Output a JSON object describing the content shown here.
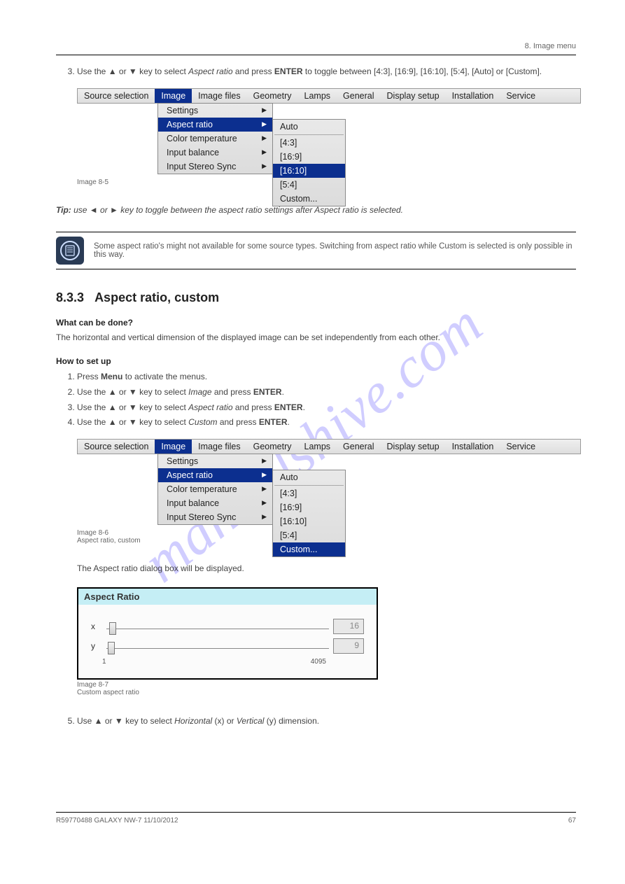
{
  "watermark": "manualshive.com",
  "chapter": "8. Image menu",
  "intro_steps": [
    {
      "t": "Use the ▲ or ▼ key to select ",
      "i": "Aspect ratio",
      "t2": " and press ",
      "b": "ENTER",
      "t3": " to toggle between [4:3], [16:9], [16:10], [5:4], [Auto] or [Custom]."
    }
  ],
  "img55_caption": "Image 8-5",
  "tip_text": "Tip: use ◄ or ► key to toggle between the aspect ratio settings after Aspect ratio is selected.",
  "note_text": "Some aspect ratio's might not available for some source types. Switching from aspect ratio while Custom is selected is only possible in this way.",
  "section": {
    "num": "8.3.3",
    "title": "Aspect ratio, custom"
  },
  "what_title": "What can be done?",
  "what_body": "The horizontal and vertical dimension of the displayed image can be set independently from each other.",
  "setup_title": "How to set up",
  "setup_steps": [
    {
      "n": 1,
      "pre": "Press ",
      "b": "Menu",
      "post": " to activate the menus."
    },
    {
      "n": 2,
      "pre": "Use the ▲ or ▼ key to select ",
      "i": "Image",
      "post": " and press ",
      "b2": "ENTER",
      "post2": "."
    },
    {
      "n": 3,
      "pre": "Use the ▲ or ▼ key to select ",
      "i": "Aspect ratio",
      "post": " and press ",
      "b2": "ENTER",
      "post2": "."
    },
    {
      "n": 4,
      "pre": "Use the ▲ or ▼ key to select ",
      "i": "Custom",
      "post": " and press ",
      "b2": "ENTER",
      "post2": "."
    }
  ],
  "img56_caption_a": "Image 8-6",
  "img56_caption_b": "Aspect ratio, custom",
  "after56": "The Aspect ratio dialog box will be displayed.",
  "img57_caption_a": "Image 8-7",
  "img57_caption_b": "Custom aspect ratio",
  "step5": {
    "pre": "Use ▲ or ▼ key to select ",
    "i": "Horizontal",
    "mid": " (x) or ",
    "i2": "Vertical",
    "post": " (y) dimension."
  },
  "menubar_items": [
    "Source selection",
    "Image",
    "Image files",
    "Geometry",
    "Lamps",
    "General",
    "Display setup",
    "Installation",
    "Service"
  ],
  "submenu_items": [
    {
      "label": "Settings",
      "arrow": true
    },
    {
      "label": "Aspect ratio",
      "arrow": true,
      "selected": true
    },
    {
      "label": "Color temperature",
      "arrow": true
    },
    {
      "label": "Input balance",
      "arrow": true
    },
    {
      "label": "Input Stereo Sync",
      "arrow": true
    }
  ],
  "subsub_a": [
    "Auto",
    "[4:3]",
    "[16:9]",
    "[16:10]",
    "[5:4]",
    "Custom..."
  ],
  "subsub_a_selected": "[16:10]",
  "subsub_b_selected": "Custom...",
  "aspect_dialog": {
    "title": "Aspect Ratio",
    "x_label": "x",
    "y_label": "y",
    "x_val": "16",
    "y_val": "9",
    "scale_min": "1",
    "scale_max": "4095"
  },
  "footer_left": "R59770488 GALAXY NW-7 11/10/2012",
  "footer_right": "67"
}
